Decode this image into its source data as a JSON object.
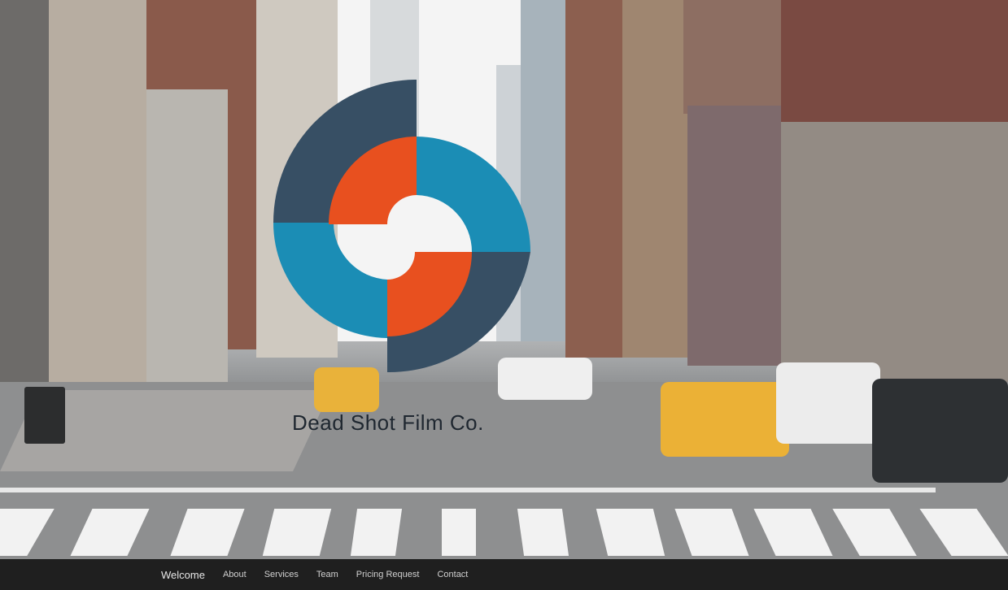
{
  "brand": {
    "name": "Dead Shot Film Co."
  },
  "logo": {
    "icon": "circular-shutter-logo-icon",
    "colors": {
      "navy": "#374f64",
      "blue": "#1b8db5",
      "orange": "#e8501f"
    }
  },
  "nav": {
    "items": [
      {
        "label": "Welcome",
        "active": true
      },
      {
        "label": "About"
      },
      {
        "label": "Services"
      },
      {
        "label": "Team"
      },
      {
        "label": "Pricing Request"
      },
      {
        "label": "Contact"
      }
    ]
  },
  "colors": {
    "navbar_bg": "#1f1f1f",
    "nav_text": "#d0d0d0"
  }
}
